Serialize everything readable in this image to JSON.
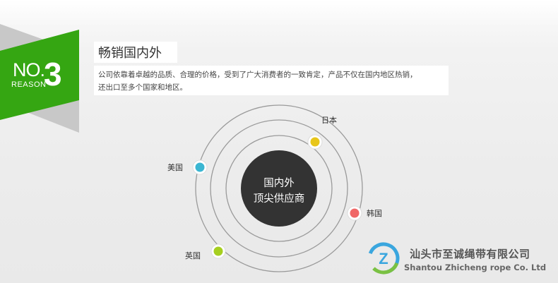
{
  "badge": {
    "no_label": "NO.",
    "number": "3",
    "sub_label": "REASON",
    "color": "#35a612",
    "shadow_color": "#c2c2c2"
  },
  "section": {
    "title": "畅销国内外",
    "description_line1": "公司依靠着卓越的品质、合理的价格，受到了广大消费者的一致肯定，产品不仅在国内地区热销，",
    "description_line2": "还出口至多个国家和地区。"
  },
  "orbit": {
    "center_line1": "国内外",
    "center_line2": "顶尖供应商",
    "countries": [
      {
        "name": "日本",
        "dot_color": "#e8c61a"
      },
      {
        "name": "美国",
        "dot_color": "#3bb6d2"
      },
      {
        "name": "韩国",
        "dot_color": "#f06767"
      },
      {
        "name": "英国",
        "dot_color": "#a6cf20"
      }
    ]
  },
  "company": {
    "name_cn": "汕头市至诚绳带有限公司",
    "name_en": "Shantou Zhicheng rope Co. Ltd"
  }
}
